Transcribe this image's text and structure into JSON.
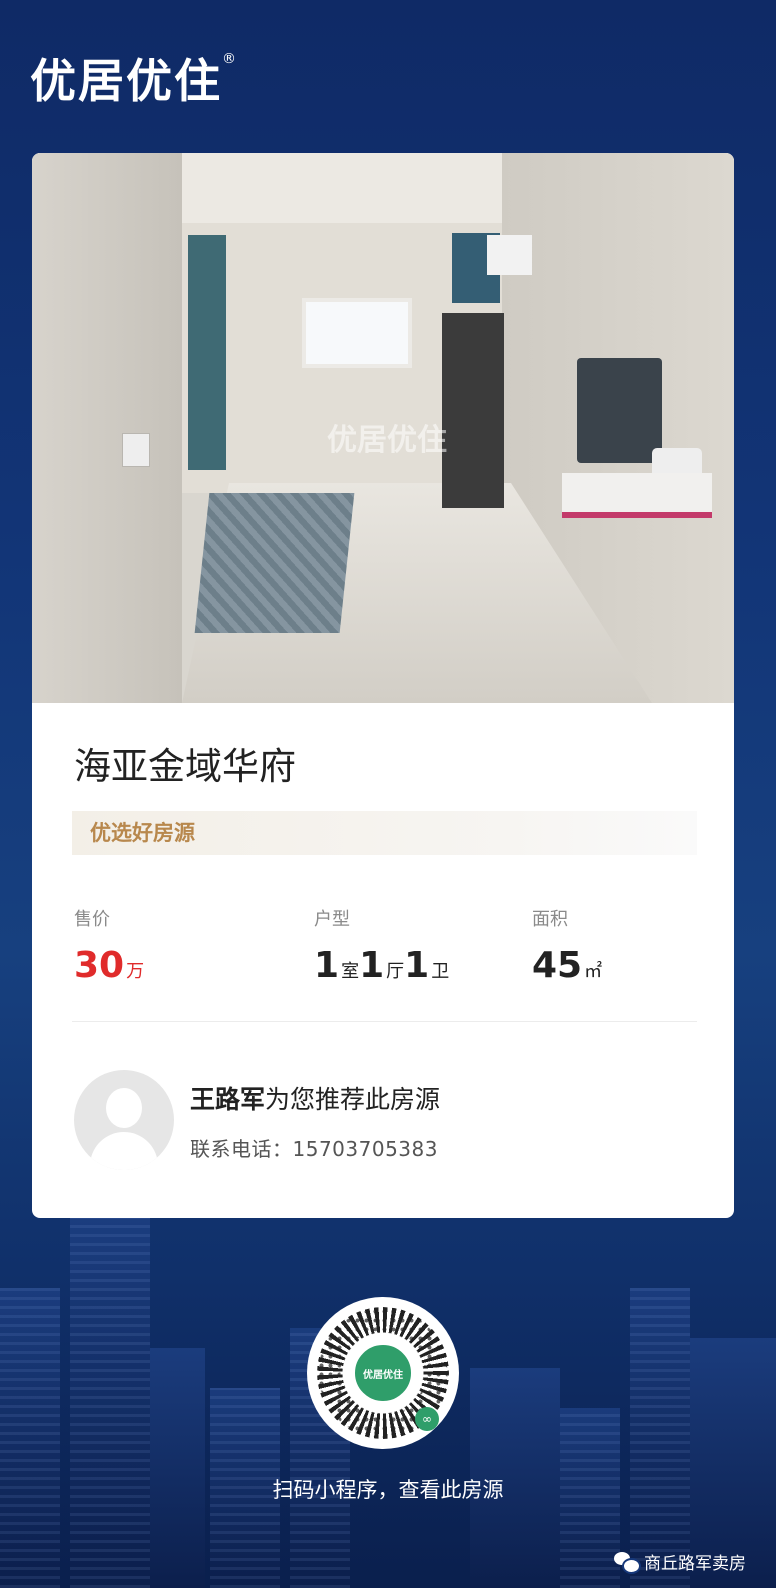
{
  "brand": {
    "logo_text": "优居优住",
    "registered_mark": "®"
  },
  "listing": {
    "photo_watermark": "优居优住",
    "title": "海亚金域华府",
    "tag": "优选好房源",
    "stats": {
      "price": {
        "label": "售价",
        "value": "30",
        "unit": "万"
      },
      "layout": {
        "label": "户型",
        "room_count": "1",
        "room_unit": "室",
        "hall_count": "1",
        "hall_unit": "厅",
        "bath_count": "1",
        "bath_unit": "卫"
      },
      "area": {
        "label": "面积",
        "value": "45",
        "unit": "㎡"
      }
    }
  },
  "agent": {
    "name": "王路军",
    "recommend_text": "为您推荐此房源",
    "phone_label": "联系电话：",
    "phone": "15703705383"
  },
  "qr": {
    "center_text": "优居优住",
    "caption": "扫码小程序，查看此房源"
  },
  "footer": {
    "account_name": "商丘路军卖房",
    "icon": "wechat-icon"
  },
  "colors": {
    "price_red": "#e02b2b",
    "tag_gold": "#b8884d",
    "background_navy": "#123577",
    "qr_green": "#2f9e6a"
  }
}
